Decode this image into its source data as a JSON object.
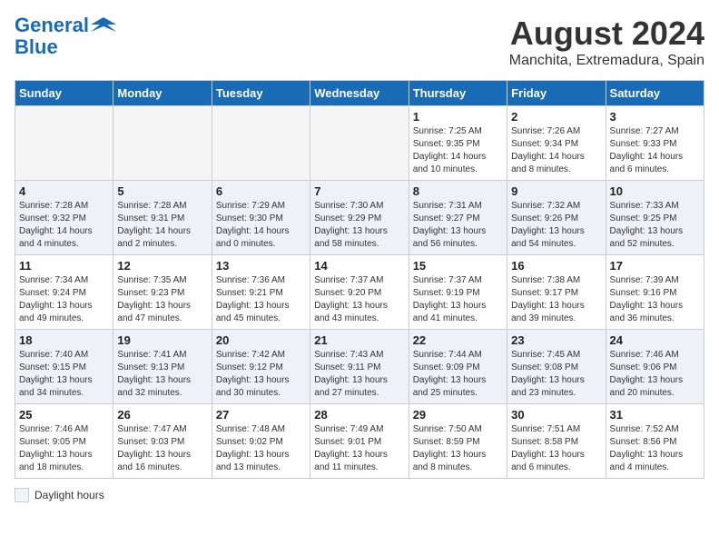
{
  "header": {
    "logo_line1": "General",
    "logo_line2": "Blue",
    "month_year": "August 2024",
    "location": "Manchita, Extremadura, Spain"
  },
  "weekdays": [
    "Sunday",
    "Monday",
    "Tuesday",
    "Wednesday",
    "Thursday",
    "Friday",
    "Saturday"
  ],
  "weeks": [
    [
      {
        "day": "",
        "info": ""
      },
      {
        "day": "",
        "info": ""
      },
      {
        "day": "",
        "info": ""
      },
      {
        "day": "",
        "info": ""
      },
      {
        "day": "1",
        "info": "Sunrise: 7:25 AM\nSunset: 9:35 PM\nDaylight: 14 hours\nand 10 minutes."
      },
      {
        "day": "2",
        "info": "Sunrise: 7:26 AM\nSunset: 9:34 PM\nDaylight: 14 hours\nand 8 minutes."
      },
      {
        "day": "3",
        "info": "Sunrise: 7:27 AM\nSunset: 9:33 PM\nDaylight: 14 hours\nand 6 minutes."
      }
    ],
    [
      {
        "day": "4",
        "info": "Sunrise: 7:28 AM\nSunset: 9:32 PM\nDaylight: 14 hours\nand 4 minutes."
      },
      {
        "day": "5",
        "info": "Sunrise: 7:28 AM\nSunset: 9:31 PM\nDaylight: 14 hours\nand 2 minutes."
      },
      {
        "day": "6",
        "info": "Sunrise: 7:29 AM\nSunset: 9:30 PM\nDaylight: 14 hours\nand 0 minutes."
      },
      {
        "day": "7",
        "info": "Sunrise: 7:30 AM\nSunset: 9:29 PM\nDaylight: 13 hours\nand 58 minutes."
      },
      {
        "day": "8",
        "info": "Sunrise: 7:31 AM\nSunset: 9:27 PM\nDaylight: 13 hours\nand 56 minutes."
      },
      {
        "day": "9",
        "info": "Sunrise: 7:32 AM\nSunset: 9:26 PM\nDaylight: 13 hours\nand 54 minutes."
      },
      {
        "day": "10",
        "info": "Sunrise: 7:33 AM\nSunset: 9:25 PM\nDaylight: 13 hours\nand 52 minutes."
      }
    ],
    [
      {
        "day": "11",
        "info": "Sunrise: 7:34 AM\nSunset: 9:24 PM\nDaylight: 13 hours\nand 49 minutes."
      },
      {
        "day": "12",
        "info": "Sunrise: 7:35 AM\nSunset: 9:23 PM\nDaylight: 13 hours\nand 47 minutes."
      },
      {
        "day": "13",
        "info": "Sunrise: 7:36 AM\nSunset: 9:21 PM\nDaylight: 13 hours\nand 45 minutes."
      },
      {
        "day": "14",
        "info": "Sunrise: 7:37 AM\nSunset: 9:20 PM\nDaylight: 13 hours\nand 43 minutes."
      },
      {
        "day": "15",
        "info": "Sunrise: 7:37 AM\nSunset: 9:19 PM\nDaylight: 13 hours\nand 41 minutes."
      },
      {
        "day": "16",
        "info": "Sunrise: 7:38 AM\nSunset: 9:17 PM\nDaylight: 13 hours\nand 39 minutes."
      },
      {
        "day": "17",
        "info": "Sunrise: 7:39 AM\nSunset: 9:16 PM\nDaylight: 13 hours\nand 36 minutes."
      }
    ],
    [
      {
        "day": "18",
        "info": "Sunrise: 7:40 AM\nSunset: 9:15 PM\nDaylight: 13 hours\nand 34 minutes."
      },
      {
        "day": "19",
        "info": "Sunrise: 7:41 AM\nSunset: 9:13 PM\nDaylight: 13 hours\nand 32 minutes."
      },
      {
        "day": "20",
        "info": "Sunrise: 7:42 AM\nSunset: 9:12 PM\nDaylight: 13 hours\nand 30 minutes."
      },
      {
        "day": "21",
        "info": "Sunrise: 7:43 AM\nSunset: 9:11 PM\nDaylight: 13 hours\nand 27 minutes."
      },
      {
        "day": "22",
        "info": "Sunrise: 7:44 AM\nSunset: 9:09 PM\nDaylight: 13 hours\nand 25 minutes."
      },
      {
        "day": "23",
        "info": "Sunrise: 7:45 AM\nSunset: 9:08 PM\nDaylight: 13 hours\nand 23 minutes."
      },
      {
        "day": "24",
        "info": "Sunrise: 7:46 AM\nSunset: 9:06 PM\nDaylight: 13 hours\nand 20 minutes."
      }
    ],
    [
      {
        "day": "25",
        "info": "Sunrise: 7:46 AM\nSunset: 9:05 PM\nDaylight: 13 hours\nand 18 minutes."
      },
      {
        "day": "26",
        "info": "Sunrise: 7:47 AM\nSunset: 9:03 PM\nDaylight: 13 hours\nand 16 minutes."
      },
      {
        "day": "27",
        "info": "Sunrise: 7:48 AM\nSunset: 9:02 PM\nDaylight: 13 hours\nand 13 minutes."
      },
      {
        "day": "28",
        "info": "Sunrise: 7:49 AM\nSunset: 9:01 PM\nDaylight: 13 hours\nand 11 minutes."
      },
      {
        "day": "29",
        "info": "Sunrise: 7:50 AM\nSunset: 8:59 PM\nDaylight: 13 hours\nand 8 minutes."
      },
      {
        "day": "30",
        "info": "Sunrise: 7:51 AM\nSunset: 8:58 PM\nDaylight: 13 hours\nand 6 minutes."
      },
      {
        "day": "31",
        "info": "Sunrise: 7:52 AM\nSunset: 8:56 PM\nDaylight: 13 hours\nand 4 minutes."
      }
    ]
  ],
  "legend": {
    "label": "Daylight hours"
  }
}
